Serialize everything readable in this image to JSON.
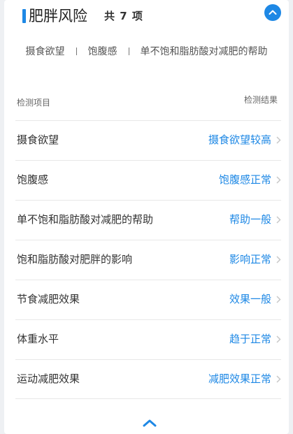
{
  "header": {
    "title": "肥胖风险",
    "count": "共 7 项",
    "collapse_icon": "chevron-up-icon",
    "accent_color": "#1e88e5"
  },
  "summary": {
    "items": [
      "摄食欲望",
      "饱腹感",
      "单不饱和脂肪酸对减肥的帮助"
    ]
  },
  "table": {
    "col_item": "检测项目",
    "col_result": "检测结果",
    "rows": [
      {
        "name": "摄食欲望",
        "result": "摄食欲望较高"
      },
      {
        "name": "饱腹感",
        "result": "饱腹感正常"
      },
      {
        "name": "单不饱和脂肪酸对减肥的帮助",
        "result": "帮助一般"
      },
      {
        "name": "饱和脂肪酸对肥胖的影响",
        "result": "影响正常"
      },
      {
        "name": "节食减肥效果",
        "result": "效果一般"
      },
      {
        "name": "体重水平",
        "result": "趋于正常"
      },
      {
        "name": "运动减肥效果",
        "result": "减肥效果正常"
      }
    ]
  },
  "footer": {
    "toggle_icon": "chevron-up-icon"
  }
}
